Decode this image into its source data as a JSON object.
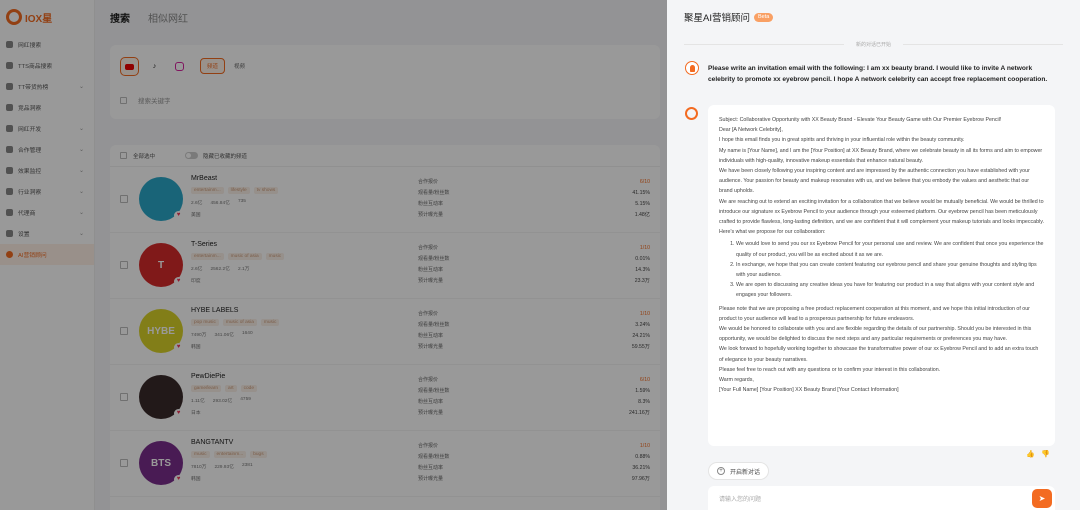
{
  "app": {
    "logo_text": "IOX星",
    "sidebar": [
      {
        "label": "网红搜索",
        "chev": false
      },
      {
        "label": "TTS商品搜索",
        "chev": false
      },
      {
        "label": "TT带货热榜",
        "chev": true
      },
      {
        "label": "竞品洞察",
        "chev": false
      },
      {
        "label": "网红开发",
        "chev": true
      },
      {
        "label": "合作管理",
        "chev": true
      },
      {
        "label": "效果监控",
        "chev": true
      },
      {
        "label": "行业洞察",
        "chev": true
      },
      {
        "label": "代理商",
        "chev": true
      },
      {
        "label": "设置",
        "chev": true
      },
      {
        "label": "AI营销顾问",
        "chev": false
      }
    ],
    "tabs": [
      "搜索",
      "相似网红"
    ],
    "filter": {
      "pill_on": "频道",
      "pill_off": "视频",
      "search_placeholder": "搜索关键字"
    },
    "list_head": {
      "select_all": "全部选中",
      "hide_label": "隐藏已收藏的频道"
    },
    "metric_labels": [
      "合作报价",
      "观看量/粉丝数",
      "粉丝互动率",
      "预计曝光量"
    ],
    "rows": [
      {
        "name": "MrBeast",
        "avatar_text": "",
        "avatar_color": "#2aa7c9",
        "tags": [
          "entertainm...",
          "lifestyle",
          "tv shows"
        ],
        "stats": [
          "2.6亿",
          "456.84亿",
          "735"
        ],
        "loc": "美国",
        "vals": [
          "6/10",
          "41.15%",
          "5.15%",
          "1.48亿"
        ]
      },
      {
        "name": "T-Series",
        "avatar_text": "T",
        "avatar_color": "#d62b2b",
        "tags": [
          "entertainm...",
          "music of asia",
          "music"
        ],
        "stats": [
          "2.6亿",
          "2562.2亿",
          "2.1万"
        ],
        "loc": "印度",
        "vals": [
          "1/10",
          "0.01%",
          "14.3%",
          "23.3万"
        ]
      },
      {
        "name": "HYBE LABELS",
        "avatar_text": "HYBE",
        "avatar_color": "#d9d229",
        "tags": [
          "pop music",
          "music of asia",
          "music"
        ],
        "stats": [
          "7490万",
          "341.06亿",
          "1640"
        ],
        "loc": "韩国",
        "vals": [
          "1/10",
          "3.24%",
          "24.21%",
          "59.55万"
        ]
      },
      {
        "name": "PewDiePie",
        "avatar_text": "",
        "avatar_color": "#3a2a2a",
        "tags": [
          "game/learn",
          "art",
          "code"
        ],
        "stats": [
          "1.11亿",
          "293.02亿",
          "4759"
        ],
        "loc": "日本",
        "vals": [
          "6/10",
          "1.59%",
          "8.3%",
          "241.16万"
        ]
      },
      {
        "name": "BANGTANTV",
        "avatar_text": "BTS",
        "avatar_color": "#7a2d8c",
        "tags": [
          "music",
          "entertainm...",
          "bugs"
        ],
        "stats": [
          "7810万",
          "229.93亿",
          "2381"
        ],
        "loc": "韩国",
        "vals": [
          "1/10",
          "0.88%",
          "36.21%",
          "97.96万"
        ]
      }
    ]
  },
  "drawer": {
    "title": "聚星AI营销顾问",
    "beta": "Beta",
    "divider": "新的对话已开始",
    "user_message": "Please write an invitation email with the following: I am xx beauty brand. I would like to invite A network celebrity to promote xx eyebrow pencil. I hope A network celebrity can accept free replacement cooperation.",
    "ai_intro": [
      "Subject: Collaborative Opportunity with XX Beauty Brand - Elevate Your Beauty Game with Our Premier Eyebrow Pencil!",
      "Dear [A Network Celebrity],",
      "I hope this email finds you in great spirits and thriving in your influential role within the beauty community.",
      "My name is [Your Name], and I am the [Your Position] at XX Beauty Brand, where we celebrate beauty in all its forms and aim to empower individuals with high-quality, innovative makeup essentials that enhance natural beauty.",
      "We have been closely following your inspiring content and are impressed by the authentic connection you have established with your audience. Your passion for beauty and makeup resonates with us, and we believe that you embody the values and aesthetic that our brand upholds.",
      "We are reaching out to extend an exciting invitation for a collaboration that we believe would be mutually beneficial. We would be thrilled to introduce our signature xx Eyebrow Pencil to your audience through your esteemed platform. Our eyebrow pencil has been meticulously crafted to provide flawless, long-lasting definition, and we are confident that it will complement your makeup tutorials and looks impeccably.",
      "Here's what we propose for our collaboration:"
    ],
    "ai_list": [
      "We would love to send you our xx Eyebrow Pencil for your personal use and review. We are confident that once you experience the quality of our product, you will be as excited about it as we are.",
      "In exchange, we hope that you can create content featuring our eyebrow pencil and share your genuine thoughts and styling tips with your audience.",
      "We are open to discussing any creative ideas you have for featuring our product in a way that aligns with your content style and engages your followers."
    ],
    "ai_outro": [
      "Please note that we are proposing a free product replacement cooperation at this moment, and we hope this initial introduction of our product to your audience will lead to a prosperous partnership for future endeavors.",
      "We would be honored to collaborate with you and are flexible regarding the details of our partnership. Should you be interested in this opportunity, we would be delighted to discuss the next steps and any particular requirements or preferences you may have.",
      "We look forward to hopefully working together to showcase the transformative power of our xx Eyebrow Pencil and to add an extra touch of elegance to your beauty narratives.",
      "Please feel free to reach out with any questions or to confirm your interest in this collaboration.",
      "Warm regards,",
      "[Your Full Name] [Your Position] XX Beauty Brand [Your Contact Information]"
    ],
    "new_chat": "开启新对话",
    "input_placeholder": "请输入您的问题",
    "accent": "#f36b21"
  }
}
